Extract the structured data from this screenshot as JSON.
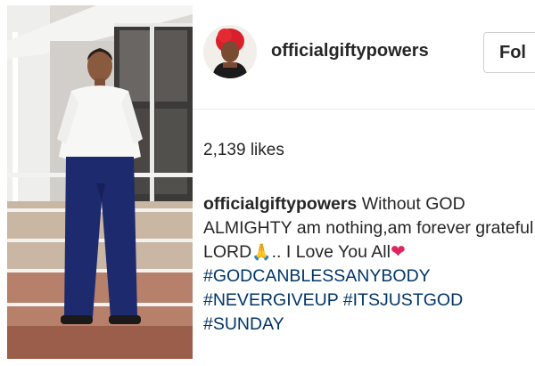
{
  "post": {
    "username": "officialgiftypowers",
    "follow_label": "Fol",
    "likes": "2,139 likes",
    "caption": {
      "username": "officialgiftypowers",
      "text_part1": "Without GOD ALMIGHTY am nothing,am forever grateful LORD",
      "pray_emoji": "🙏",
      "text_part2": ".. I Love You All",
      "heart_emoji": "❤",
      "hashtags": [
        "#GODCANBLESSANYBODY",
        "#NEVERGIVEUP",
        "#ITSJUSTGOD",
        "#SUNDAY"
      ]
    },
    "icons": {
      "avatar": "profile-avatar",
      "pray": "folded-hands-emoji",
      "heart": "red-heart-emoji"
    },
    "colors": {
      "hashtag": "#003569",
      "heart": "#e0245e",
      "text": "#262626"
    }
  }
}
